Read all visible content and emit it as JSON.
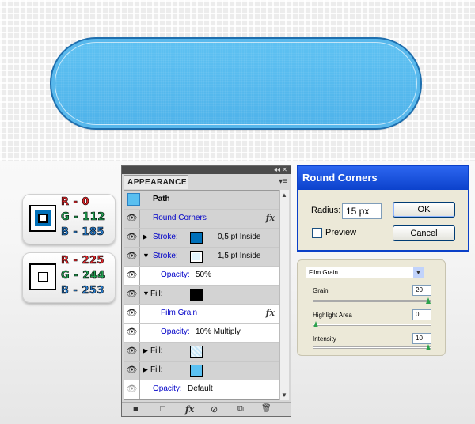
{
  "badges": [
    {
      "r": "R - 0",
      "g": "G - 112",
      "b": "B - 185",
      "swatch": "#0070b9"
    },
    {
      "r": "R - 225",
      "g": "G - 244",
      "b": "B - 253",
      "swatch": "#e1f4fd"
    }
  ],
  "appearance": {
    "tab": "APPEARANCE",
    "top_controls": "◂◂ ✕",
    "menu_icon": "▾≡",
    "path_label": "Path",
    "rows": [
      {
        "type": "effect",
        "label": "Round Corners",
        "fx": "fx"
      },
      {
        "type": "stroke",
        "label": "Stroke:",
        "value": "0,5 pt  Inside",
        "color": "#0070b9",
        "expanded": false
      },
      {
        "type": "stroke",
        "label": "Stroke:",
        "value": "1,5 pt  Inside",
        "color": "#e1f4fd",
        "expanded": true
      },
      {
        "type": "opacity",
        "label": "Opacity:",
        "value": "50%"
      },
      {
        "type": "fill",
        "label": "Fill:",
        "color": "#000000",
        "expanded": true
      },
      {
        "type": "effect2",
        "label": "Film Grain",
        "fx": "fx"
      },
      {
        "type": "opacity",
        "label": "Opacity:",
        "value": "10% Multiply"
      },
      {
        "type": "fill",
        "label": "Fill:",
        "color": "#c6e6f7",
        "expanded": false
      },
      {
        "type": "fill",
        "label": "Fill:",
        "color": "#5bc1f2",
        "expanded": false
      },
      {
        "type": "opacity-bottom",
        "label": "Opacity:",
        "value": "Default"
      }
    ],
    "bottom_icons": [
      "■",
      "□",
      "fx",
      "⊘",
      "⧉",
      "🗑"
    ]
  },
  "round_corners": {
    "title": "Round Corners",
    "radius_label": "Radius:",
    "radius_value": "15 px",
    "preview_label": "Preview",
    "ok_label": "OK",
    "cancel_label": "Cancel"
  },
  "film_grain": {
    "select_value": "Film Grain",
    "grain_label": "Grain",
    "grain_value": "20",
    "grain_level": 1.0,
    "highlight_label": "Highlight Area",
    "highlight_value": "0",
    "highlight_level": 0.0,
    "intensity_label": "Intensity",
    "intensity_value": "10",
    "intensity_level": 1.0
  },
  "colors": {
    "button_fill": "#58b8ec",
    "button_stroke": "#1f6fae",
    "accent_green": "#2ba24c"
  }
}
